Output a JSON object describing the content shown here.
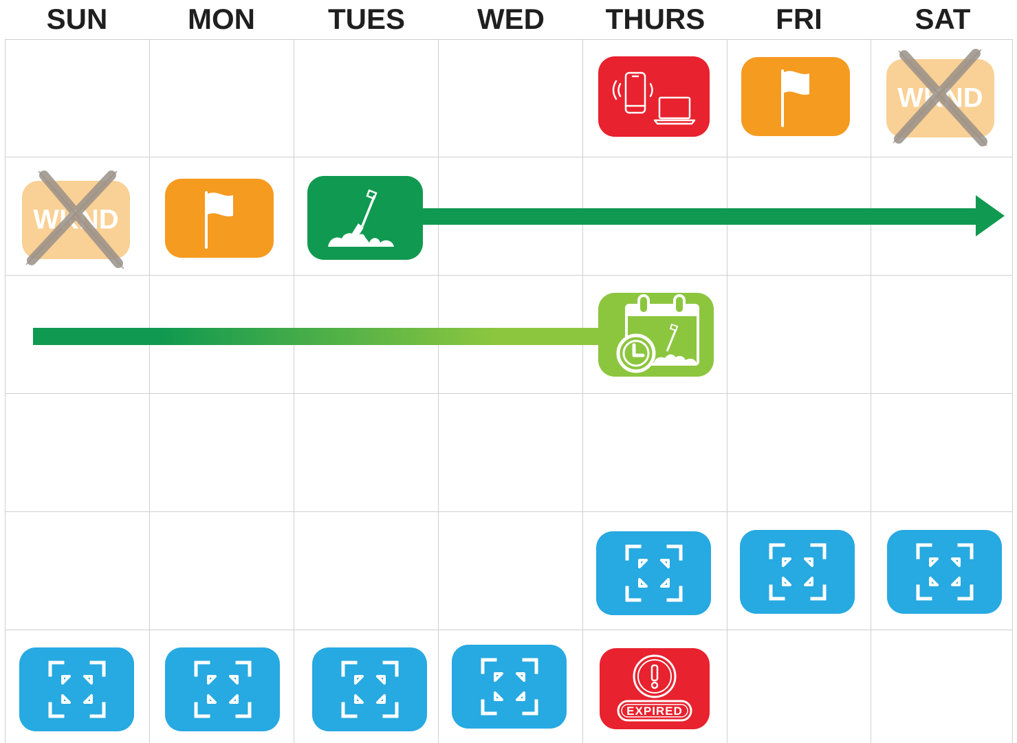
{
  "header": {
    "days": [
      "SUN",
      "MON",
      "TUES",
      "WED",
      "THURS",
      "FRI",
      "SAT"
    ]
  },
  "colors": {
    "red": "#e8222e",
    "orange": "#f59b20",
    "dark_green": "#109950",
    "light_green": "#8cc63f",
    "blue": "#27a9e1",
    "wknd_bg": "#f9d095",
    "wknd_x": "#9a9189",
    "grid": "#cfcfcf"
  },
  "calendar": {
    "wknd_label": "WKND",
    "expired_label": "EXPIRED",
    "icons": {
      "devices": "phone-laptop-icon",
      "flag": "flag-icon",
      "shovel": "groundbreaking-shovel-icon",
      "scheduled": "calendar-clock-shovel-icon",
      "expand": "expand-arrows-icon",
      "expired": "expired-alert-icon"
    }
  }
}
